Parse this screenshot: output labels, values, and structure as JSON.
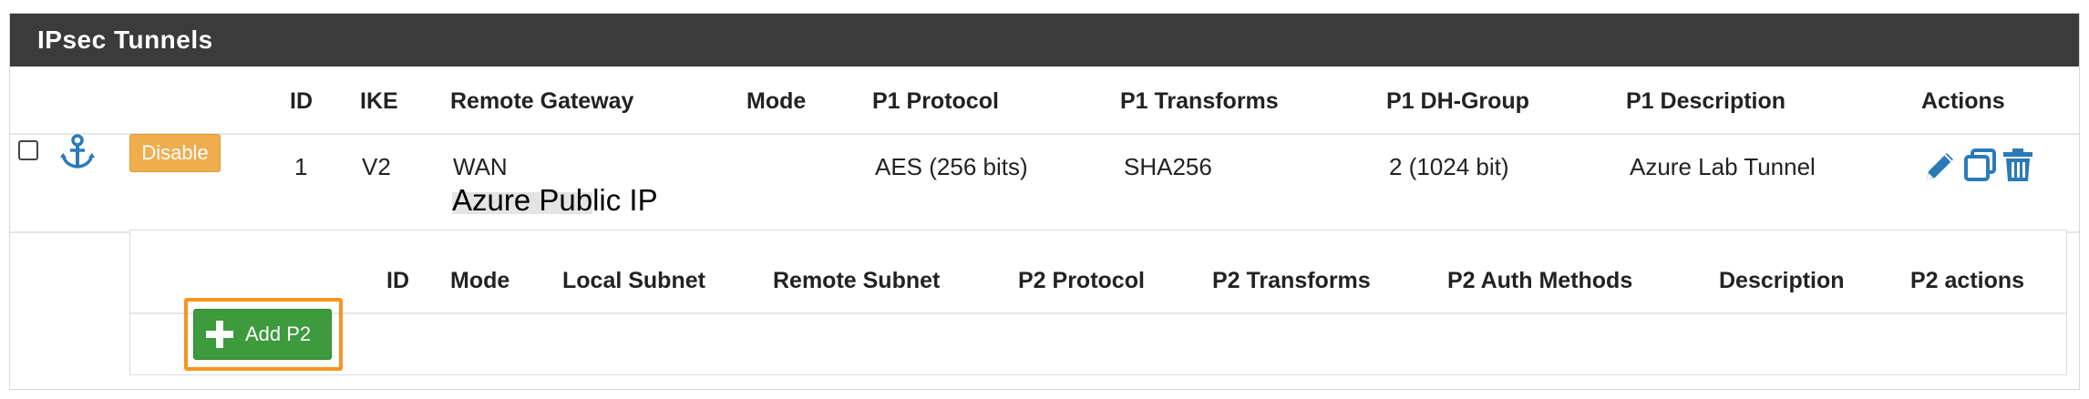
{
  "panel": {
    "title": "IPsec Tunnels"
  },
  "p1_headers": {
    "id": "ID",
    "ike": "IKE",
    "remote_gateway": "Remote Gateway",
    "mode": "Mode",
    "protocol": "P1 Protocol",
    "transforms": "P1 Transforms",
    "dh_group": "P1 DH-Group",
    "description": "P1 Description",
    "actions": "Actions"
  },
  "p1_row": {
    "disable_label": "Disable",
    "id": "1",
    "ike": "V2",
    "remote_gateway": "WAN",
    "remote_gateway_note": "Azure Public IP",
    "mode": "",
    "protocol": "AES (256 bits)",
    "transforms": "SHA256",
    "dh_group": "2 (1024 bit)",
    "description": "Azure Lab Tunnel"
  },
  "p2_headers": {
    "id": "ID",
    "mode": "Mode",
    "local_subnet": "Local Subnet",
    "remote_subnet": "Remote Subnet",
    "protocol": "P2 Protocol",
    "transforms": "P2 Transforms",
    "auth_methods": "P2 Auth Methods",
    "description": "Description",
    "actions": "P2 actions"
  },
  "p2_actions": {
    "add_label": "Add P2"
  },
  "icons": {
    "row_select": "checkbox-icon",
    "anchor": "anchor-icon",
    "edit": "pencil-icon",
    "copy": "copy-icon",
    "delete": "trash-icon",
    "add": "plus-icon"
  },
  "colors": {
    "heading_bg": "#3b3b3b",
    "disable_btn": "#f0ad4e",
    "add_btn": "#3d9a3d",
    "icon_blue": "#2a7ab8",
    "highlight_box": "#f7941d"
  }
}
